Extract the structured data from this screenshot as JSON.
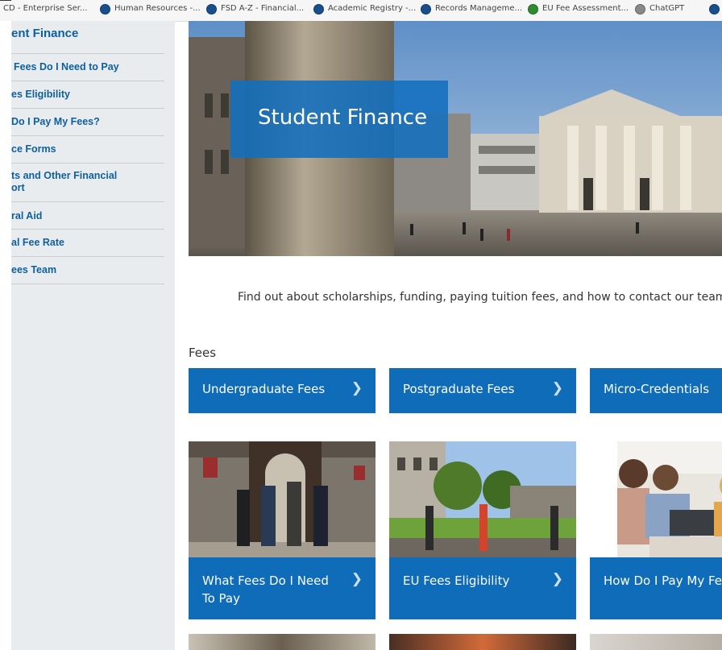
{
  "bookmarks": [
    {
      "label": "CD - Enterprise Ser...",
      "icon": "none"
    },
    {
      "label": "Human Resources -...",
      "icon": "tcd-crest-icon"
    },
    {
      "label": "FSD A-Z - Financial...",
      "icon": "tcd-crest-icon"
    },
    {
      "label": "Academic Registry -...",
      "icon": "tcd-crest-icon"
    },
    {
      "label": "Records Manageme...",
      "icon": "tcd-crest-icon"
    },
    {
      "label": "EU Fee Assessment...",
      "icon": "shield-icon"
    },
    {
      "label": "ChatGPT",
      "icon": "chatgpt-icon"
    }
  ],
  "sidebar": {
    "title": "ent Finance",
    "items": [
      {
        "label": "Fees Do I Need to Pay"
      },
      {
        "label": "es Eligibility"
      },
      {
        "label": "Do I Pay My Fees?"
      },
      {
        "label": "ce Forms"
      },
      {
        "label": "ts and Other Financial ort"
      },
      {
        "label": "ral Aid"
      },
      {
        "label": "al Fee Rate"
      },
      {
        "label": "ees Team"
      }
    ]
  },
  "hero": {
    "title": "Student Finance"
  },
  "intro": "Find out about scholarships, funding, paying tuition fees, and how to contact our team",
  "fees": {
    "heading": "Fees",
    "buttons": [
      {
        "label": "Undergraduate Fees"
      },
      {
        "label": "Postgraduate Fees"
      },
      {
        "label": "Micro-Credentials"
      }
    ],
    "cards": [
      {
        "label": "What Fees Do I Need To Pay"
      },
      {
        "label": "EU Fees Eligibility"
      },
      {
        "label": "How Do I Pay My Fee"
      }
    ]
  },
  "colors": {
    "brand_blue": "#0f6cb8",
    "sidebar_bg": "#e9ecef",
    "link_blue": "#0e5f9e"
  }
}
